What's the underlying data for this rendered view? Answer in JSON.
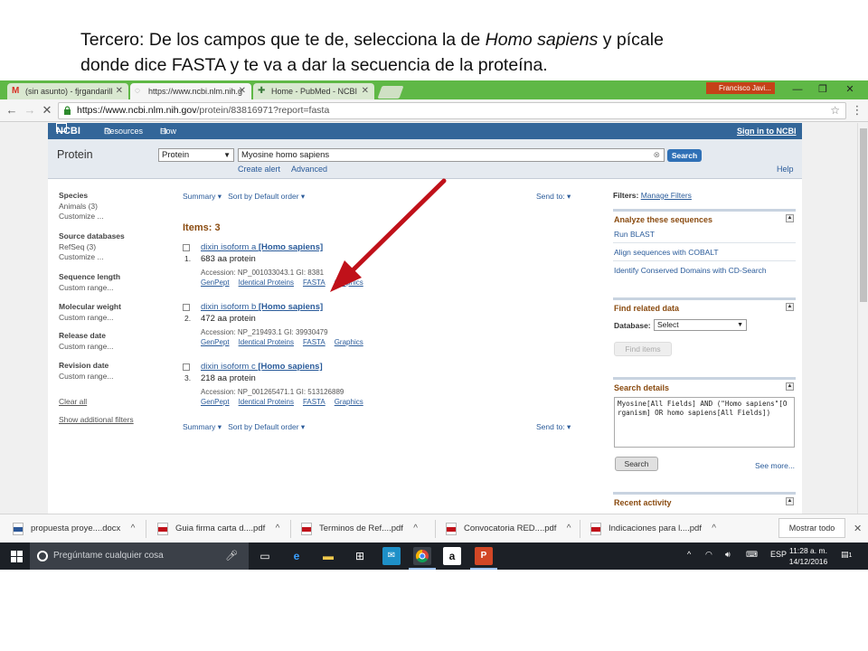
{
  "caption": {
    "line1_pre": "Tercero: De los campos que te de, selecciona la de ",
    "line1_em": "Homo sapiens",
    "line1_post": " y pícale",
    "line2": "donde dice FASTA y te va a dar la secuencia de la proteína."
  },
  "browser": {
    "tabs": [
      {
        "label": "(sin asunto) - fjrgandarill",
        "icon": "gmail-icon"
      },
      {
        "label": "https://www.ncbi.nlm.nih.g",
        "icon": "loading-icon"
      },
      {
        "label": "Home - PubMed - NCBI",
        "icon": "ncbi-icon"
      }
    ],
    "user": "Francisco Javi...",
    "url_host": "https://www.ncbi.nlm.nih.gov",
    "url_path": "/protein/83816971?report=fasta"
  },
  "ncbi": {
    "logo": "NCBI",
    "resources": "Resources",
    "howto": "How To",
    "signin": "Sign in to NCBI",
    "db_title": "Protein",
    "db_selected": "Protein",
    "term": "Myosine homo sapiens",
    "search_label": "Search",
    "create_alert": "Create alert",
    "advanced": "Advanced",
    "help": "Help"
  },
  "facets": [
    {
      "heading": "Species",
      "items": [
        "Animals (3)",
        "Customize ..."
      ]
    },
    {
      "heading": "Source databases",
      "items": [
        "RefSeq (3)",
        "Customize ..."
      ]
    },
    {
      "heading": "Sequence length",
      "items": [
        "Custom range..."
      ]
    },
    {
      "heading": "Molecular weight",
      "items": [
        "Custom range..."
      ]
    },
    {
      "heading": "Release date",
      "items": [
        "Custom range..."
      ]
    },
    {
      "heading": "Revision date",
      "items": [
        "Custom range..."
      ]
    }
  ],
  "clear_all": "Clear all",
  "show_filters": "Show additional filters",
  "toolbar": {
    "summary": "Summary ▾",
    "sort": "Sort by Default order ▾",
    "sendto": "Send to: ▾"
  },
  "items_count": "Items: 3",
  "results": [
    {
      "num": "1.",
      "title": "dixin isoform a ",
      "organism": "[Homo sapiens]",
      "desc": "683 aa protein",
      "accession": "Accession: NP_001033043.1   GI: 8381",
      "links": [
        "GenPept",
        "Identical Proteins",
        "FASTA",
        "Graphics"
      ]
    },
    {
      "num": "2.",
      "title": "dixin isoform b ",
      "organism": "[Homo sapiens]",
      "desc": "472 aa protein",
      "accession": "Accession: NP_219493.1   GI: 39930479",
      "links": [
        "GenPept",
        "Identical Proteins",
        "FASTA",
        "Graphics"
      ]
    },
    {
      "num": "3.",
      "title": "dixin isoform c ",
      "organism": "[Homo sapiens]",
      "desc": "218 aa protein",
      "accession": "Accession: NP_001265471.1   GI: 513126889",
      "links": [
        "GenPept",
        "Identical Proteins",
        "FASTA",
        "Graphics"
      ]
    }
  ],
  "right": {
    "filters_label": "Filters: ",
    "manage_filters": "Manage Filters",
    "analyze": {
      "heading": "Analyze these sequences",
      "items": [
        "Run BLAST",
        "Align sequences with COBALT",
        "Identify Conserved Domains with CD-Search"
      ]
    },
    "related": {
      "heading": "Find related data",
      "db_label": "Database:",
      "db_value": "Select",
      "find_items": "Find items"
    },
    "details": {
      "heading": "Search details",
      "query": "Myosine[All Fields] AND (\"Homo sapiens\"[Organism] OR homo sapiens[All Fields])",
      "search": "Search",
      "see_more": "See more..."
    },
    "recent": {
      "heading": "Recent activity"
    }
  },
  "downloads": [
    {
      "name": "propuesta proye....docx",
      "type": "docx"
    },
    {
      "name": "Guia firma carta d....pdf",
      "type": "pdf"
    },
    {
      "name": "Terminos de      Ref....pdf",
      "type": "pdf"
    },
    {
      "name": "Convocatoria RED....pdf",
      "type": "pdf"
    },
    {
      "name": "Indicaciones para l....pdf",
      "type": "pdf"
    }
  ],
  "show_all": "Mostrar todo",
  "taskbar": {
    "cortana": "Pregúntame cualquier cosa",
    "lang": "ESP",
    "time": "11:28 a. m.",
    "date": "14/12/2016",
    "notif_count": "1"
  },
  "colors": {
    "accent_red": "#c0111a",
    "ncbi_blue": "#336699",
    "chrome_green": "#5fb846"
  }
}
